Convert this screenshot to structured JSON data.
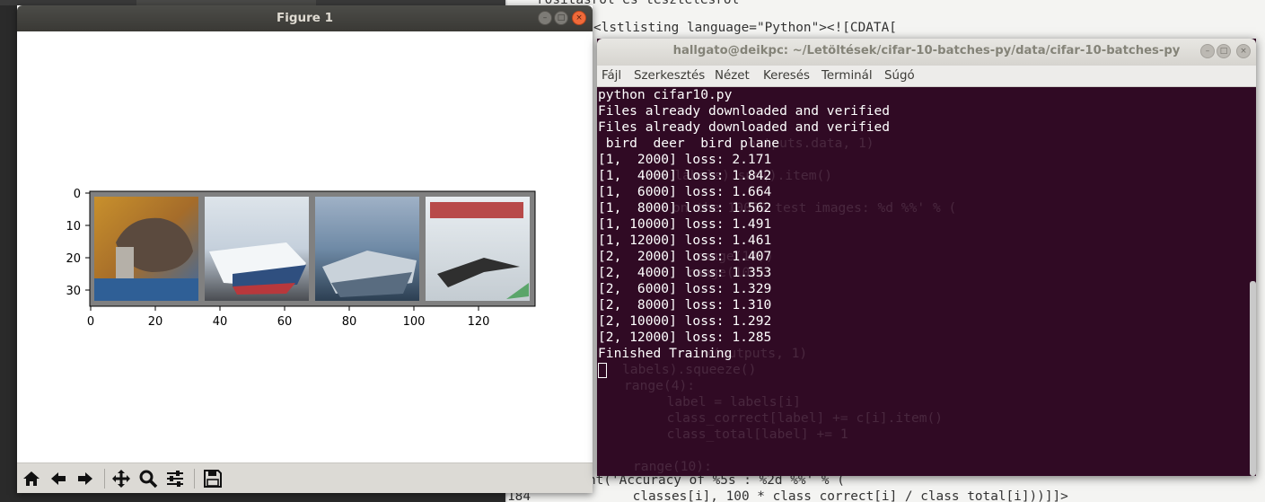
{
  "editor": {
    "lines": [
      {
        "text": "rosításról és tesztelésről"
      },
      {
        "text": "<lstlisting language=\"Python\"><![CDATA["
      },
      {
        "text": "nt('Accuracy of %5s : %2d %%' % ("
      },
      {
        "text": "    classes[i], 100 * class_correct[i] / class_total[i]))]]>"
      }
    ],
    "line_number": "184",
    "ghost_lines": [
      "outputs.data, 1)",
      "== labels).sum().item()",
      "on the 10000 test images: %d %%' % (",
      " range(10))",
      "range(10))",
      "x(outputs, 1)",
      "labels).squeeze()",
      "range(4):",
      "  label = labels[i]",
      "  class_correct[label] += c[i].item()",
      "  class_total[label] += 1",
      "range(10):"
    ]
  },
  "figure_window": {
    "title": "Figure 1",
    "buttons": {
      "minimize": "–",
      "maximize": "□",
      "close": "×"
    },
    "toolbar": [
      {
        "name": "home-icon",
        "label": "Home"
      },
      {
        "name": "back-arrow-icon",
        "label": "Back"
      },
      {
        "name": "forward-arrow-icon",
        "label": "Forward"
      },
      {
        "name": "pan-icon",
        "label": "Pan"
      },
      {
        "name": "zoom-icon",
        "label": "Zoom"
      },
      {
        "name": "configure-subplots-icon",
        "label": "Subplots"
      },
      {
        "name": "save-icon",
        "label": "Save"
      }
    ],
    "plot": {
      "xticks": [
        "0",
        "20",
        "40",
        "60",
        "80",
        "100",
        "120"
      ],
      "yticks": [
        "0",
        "10",
        "20",
        "30"
      ],
      "images": [
        "cat",
        "ship",
        "ship",
        "plane"
      ]
    }
  },
  "terminal": {
    "title": "hallgato@deikpc: ~/Letöltések/cifar-10-batches-py/data/cifar-10-batches-py",
    "menu": [
      "Fájl",
      "Szerkesztés",
      "Nézet",
      "Keresés",
      "Terminál",
      "Súgó"
    ],
    "lines": [
      "python cifar10.py",
      "Files already downloaded and verified",
      "Files already downloaded and verified",
      " bird  deer  bird plane",
      "[1,  2000] loss: 2.171",
      "[1,  4000] loss: 1.842",
      "[1,  6000] loss: 1.664",
      "[1,  8000] loss: 1.562",
      "[1, 10000] loss: 1.491",
      "[1, 12000] loss: 1.461",
      "[2,  2000] loss: 1.407",
      "[2,  4000] loss: 1.353",
      "[2,  6000] loss: 1.329",
      "[2,  8000] loss: 1.310",
      "[2, 10000] loss: 1.292",
      "[2, 12000] loss: 1.285",
      "Finished Training"
    ]
  },
  "colors": {
    "terminal_bg": "#300a24",
    "close_button": "#f06a3a"
  }
}
